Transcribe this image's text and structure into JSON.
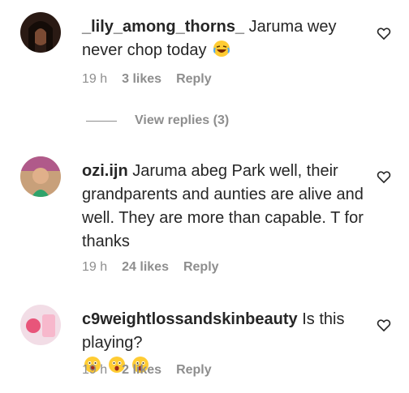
{
  "comments": [
    {
      "username": "_lily_among_thorns_",
      "text": "Jaruma wey never chop today",
      "emoji": "laughing",
      "time": "19 h",
      "likes": "3 likes",
      "reply": "Reply"
    },
    {
      "username": "ozi.ijn",
      "text": "Jaruma abeg Park well, their grandparents and aunties are alive and well. They are more than capable. T for thanks",
      "time": "19 h",
      "likes": "24 likes",
      "reply": "Reply"
    },
    {
      "username": "c9weightlossandskinbeauty",
      "text": "Is this playing?",
      "emoji": "astonished x3",
      "time": "19 h",
      "likes": "2 likes",
      "reply": "Reply"
    }
  ],
  "view_replies": "View replies (3)",
  "icons": {
    "like": "heart-outline-icon",
    "accent": "#8e8e8e"
  }
}
